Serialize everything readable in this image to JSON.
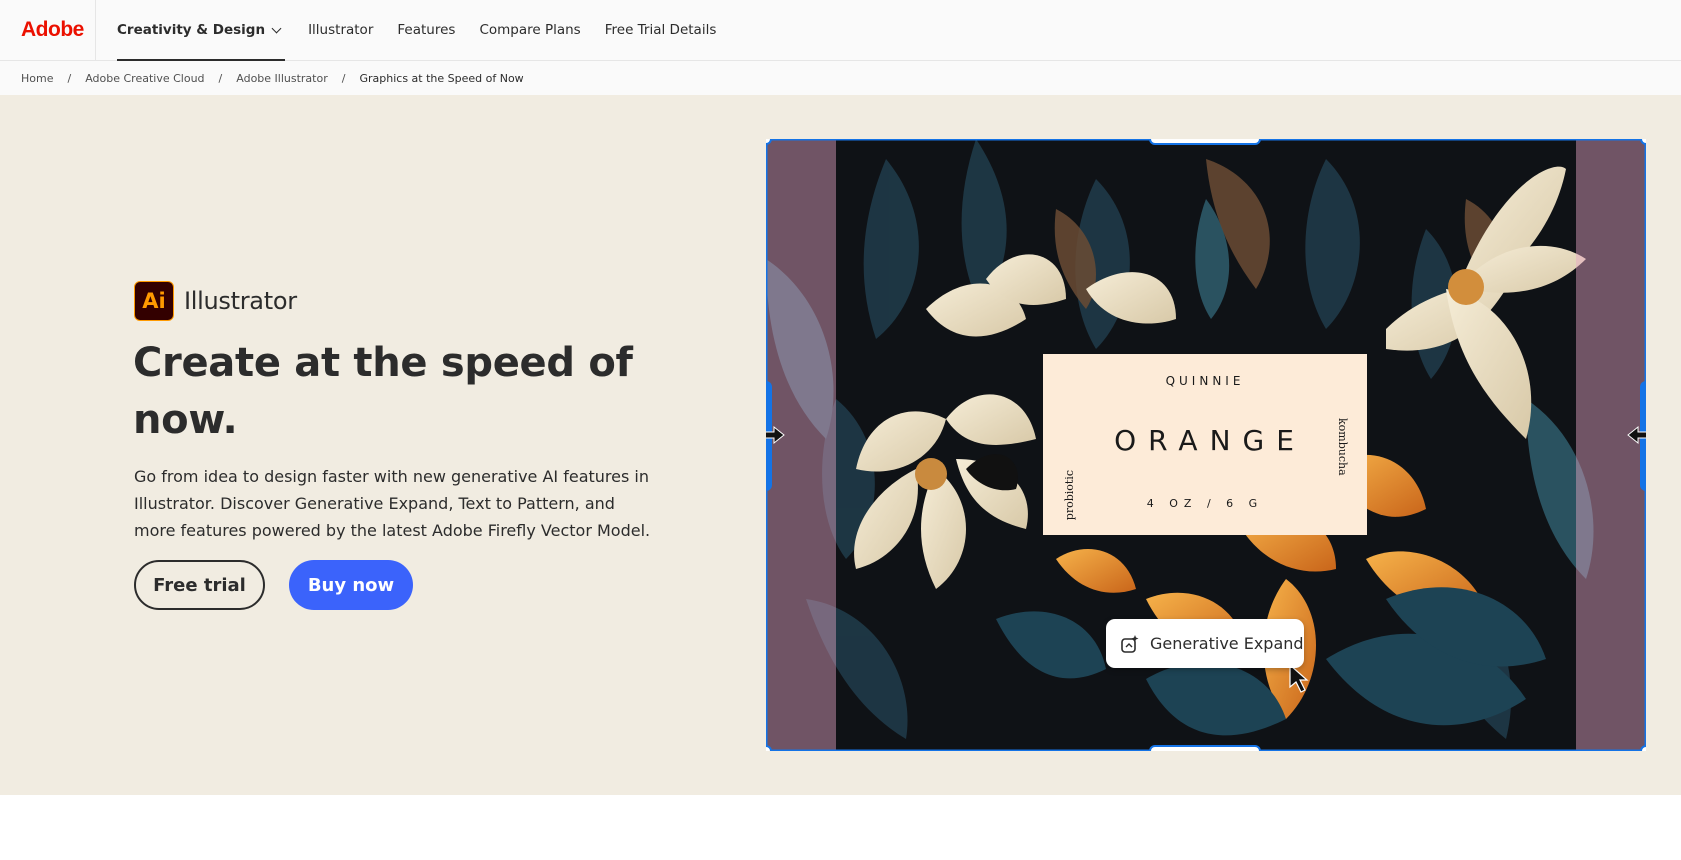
{
  "nav": {
    "logo": "Adobe",
    "primary": "Creativity & Design",
    "items": [
      {
        "label": "Illustrator"
      },
      {
        "label": "Features"
      },
      {
        "label": "Compare Plans"
      },
      {
        "label": "Free Trial Details"
      }
    ]
  },
  "breadcrumb": {
    "items": [
      "Home",
      "Adobe Creative Cloud",
      "Adobe Illustrator"
    ],
    "current": "Graphics at the Speed of Now",
    "separator": "/"
  },
  "hero": {
    "badge": "Ai",
    "product": "Illustrator",
    "headline": "Create at the speed of now.",
    "body": "Go from idea to design faster with new generative AI features in Illustrator. Discover Generative Expand, Text to Pattern, and more features powered by the latest Adobe Firefly Vector Model.",
    "cta_secondary": "Free trial",
    "cta_primary": "Buy now"
  },
  "artwork": {
    "label": {
      "brand": "QUINNIE",
      "flavor": "ORANGE",
      "size": "4 OZ / 6 G",
      "left_vertical": "probiotic",
      "right_vertical": "kombucha"
    },
    "generative_expand": "Generative Expand"
  },
  "colors": {
    "adobe_red": "#eb1000",
    "primary_blue": "#3b63fb",
    "hero_bg": "#f1ece1",
    "selection_blue": "#1473e6"
  }
}
